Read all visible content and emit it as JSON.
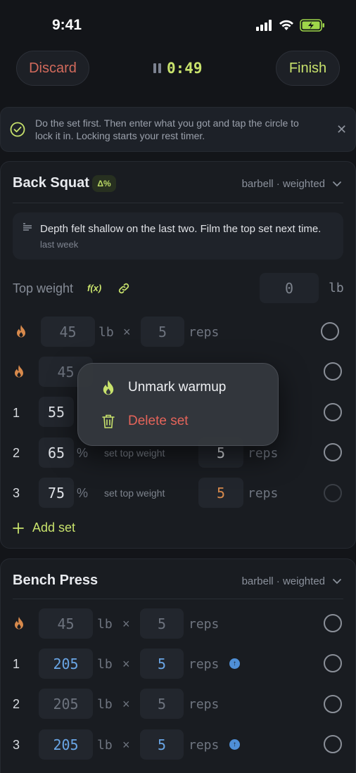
{
  "status_bar": {
    "time": "9:41",
    "icons": [
      "cellular-signal-icon",
      "wifi-icon",
      "battery-charging-icon"
    ]
  },
  "header": {
    "discard_label": "Discard",
    "timer": "0:49",
    "finish_label": "Finish"
  },
  "tip": {
    "text": "Do the set first. Then enter what you got and tap the circle to lock it in. Locking starts your rest timer."
  },
  "exercises": [
    {
      "title": "Back Squat",
      "badge": "Δ%",
      "meta": "barbell · weighted",
      "note": {
        "text": "Depth felt shallow on the last two. Film the top set next time.",
        "sub": "last week"
      },
      "top_weight": {
        "label": "Top weight",
        "fx": "f(x)",
        "value": "0",
        "unit": "lb"
      },
      "sets": [
        {
          "idx": "",
          "weight": "45",
          "unit": "lb",
          "x": "×",
          "reps": "5",
          "reps_label": "reps",
          "warmup": true
        },
        {
          "idx": "",
          "weight": "45",
          "warmup": true
        },
        {
          "idx": "1",
          "weight": "55"
        },
        {
          "idx": "2",
          "weight": "65",
          "unit": "%",
          "hint": "set top weight",
          "reps": "5",
          "reps_label": "reps"
        },
        {
          "idx": "3",
          "weight": "75",
          "unit": "%",
          "hint": "set top weight",
          "reps": "5",
          "reps_label": "reps"
        }
      ],
      "add_set_label": "Add set"
    },
    {
      "title": "Bench Press",
      "meta": "barbell · weighted",
      "sets": [
        {
          "idx": "",
          "weight": "45",
          "unit": "lb",
          "x": "×",
          "reps": "5",
          "reps_label": "reps",
          "warmup": true
        },
        {
          "idx": "1",
          "weight": "205",
          "unit": "lb",
          "x": "×",
          "reps": "5",
          "reps_label": "reps",
          "up": true
        },
        {
          "idx": "2",
          "weight": "205",
          "unit": "lb",
          "x": "×",
          "reps": "5",
          "reps_label": "reps"
        },
        {
          "idx": "3",
          "weight": "205",
          "unit": "lb",
          "x": "×",
          "reps": "5",
          "reps_label": "reps",
          "up": true
        }
      ]
    }
  ],
  "context_menu": {
    "unmark_label": "Unmark warmup",
    "delete_label": "Delete set"
  },
  "colors": {
    "accent": "#c8e26c",
    "danger": "#e5645a",
    "discard": "#d26a5c",
    "blue": "#6aa6e6",
    "warmup": "#d88a4c"
  }
}
